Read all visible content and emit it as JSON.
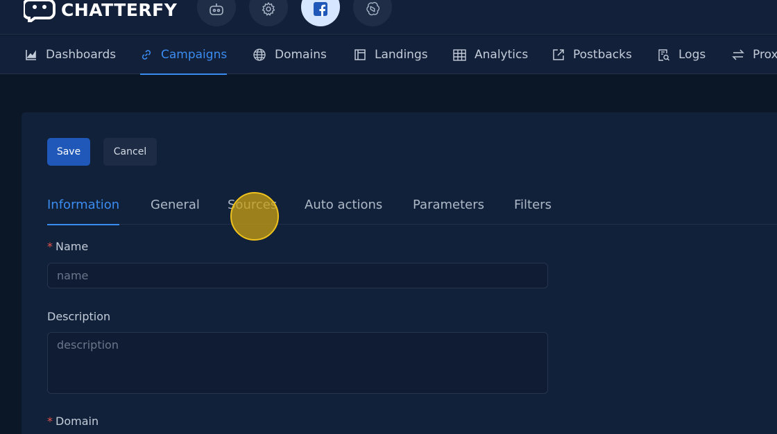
{
  "app": {
    "brand": "CHATTERFY"
  },
  "header": {
    "buttons": [
      {
        "icon": "robot-icon"
      },
      {
        "icon": "gear-icon"
      },
      {
        "icon": "facebook-icon",
        "active": true
      },
      {
        "icon": "openai-icon"
      }
    ]
  },
  "nav": {
    "items": [
      {
        "label": "Dashboards",
        "icon": "chart-icon"
      },
      {
        "label": "Campaigns",
        "icon": "link-icon",
        "active": true
      },
      {
        "label": "Domains",
        "icon": "globe-icon"
      },
      {
        "label": "Landings",
        "icon": "layout-icon"
      },
      {
        "label": "Analytics",
        "icon": "table-icon"
      },
      {
        "label": "Postbacks",
        "icon": "external-link-icon"
      },
      {
        "label": "Logs",
        "icon": "file-search-icon"
      },
      {
        "label": "Prox",
        "icon": "swap-icon"
      }
    ]
  },
  "form": {
    "save_label": "Save",
    "cancel_label": "Cancel",
    "tabs": [
      {
        "label": "Information",
        "active": true
      },
      {
        "label": "General"
      },
      {
        "label": "Sources"
      },
      {
        "label": "Auto actions"
      },
      {
        "label": "Parameters"
      },
      {
        "label": "Filters"
      }
    ],
    "fields": {
      "name": {
        "label": "Name",
        "required": true,
        "placeholder": "name",
        "value": ""
      },
      "description": {
        "label": "Description",
        "required": false,
        "placeholder": "description",
        "value": ""
      },
      "domain": {
        "label": "Domain",
        "required": true
      }
    },
    "required_marker": "*"
  },
  "colors": {
    "accent": "#3b8cf0",
    "primary_button": "#1f58b8",
    "required": "#e5534b",
    "background": "#0b1627",
    "card": "#12213a"
  }
}
